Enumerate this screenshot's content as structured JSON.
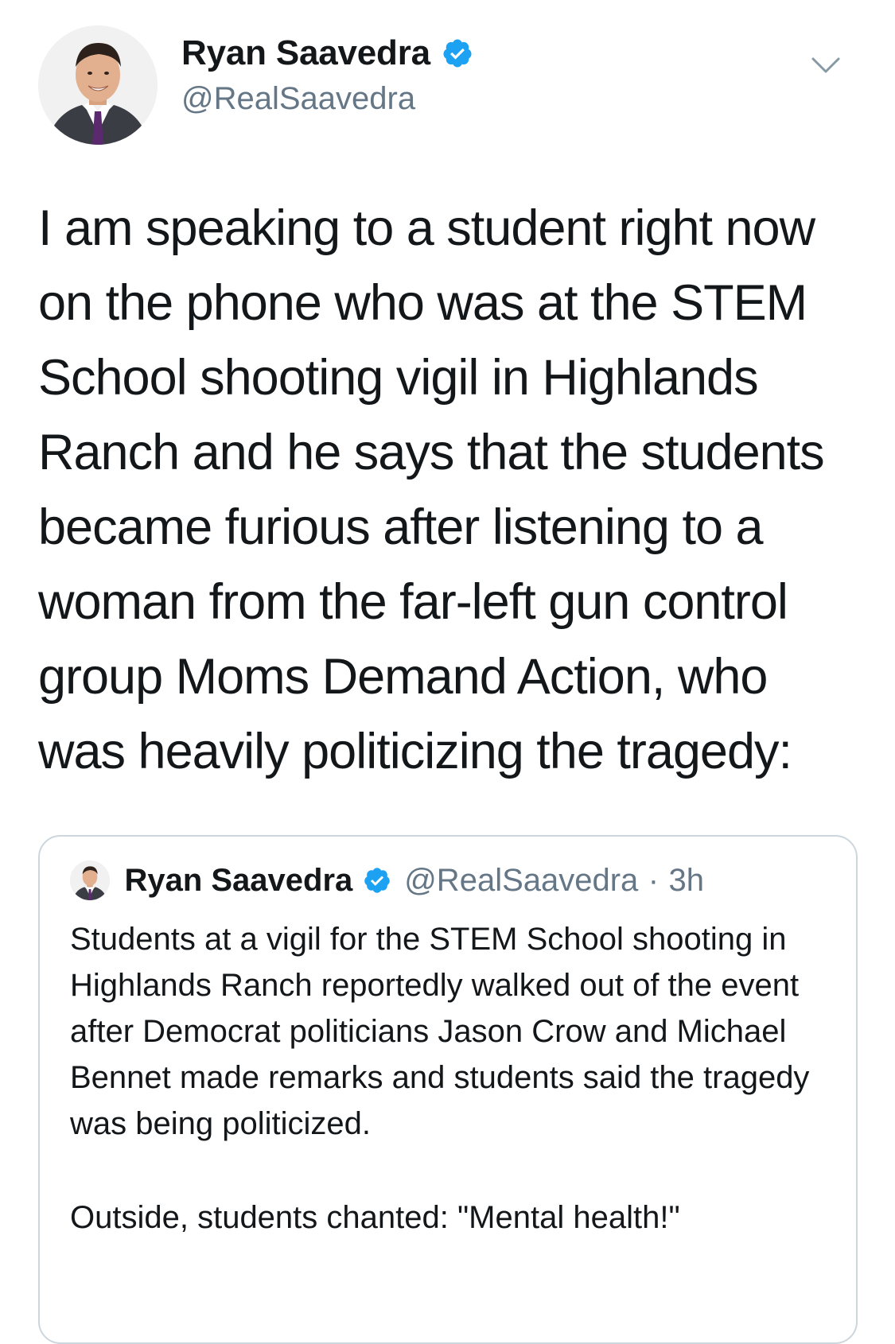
{
  "author": {
    "display_name": "Ryan Saavedra",
    "handle": "@RealSaavedra",
    "verified_icon": "verified-badge-icon"
  },
  "tweet": {
    "text": "I am speaking to a student right now on the phone who was at the STEM School shooting vigil in Highlands Ranch and he says that the students became furious after listening to a woman from the far-left gun control group Moms Demand Action, who was heavily politicizing the tragedy:"
  },
  "quoted_tweet": {
    "display_name": "Ryan Saavedra",
    "handle": "@RealSaavedra",
    "separator": "·",
    "time": "3h",
    "text": "Students at a vigil for the STEM School shooting in Highlands Ranch reportedly walked out of the event after Democrat politicians Jason Crow and Michael Bennet made remarks and students said the tragedy was being politicized.",
    "text_continued": "Outside, students chanted: \"Mental health!\""
  },
  "colors": {
    "text_primary": "#14171a",
    "text_secondary": "#657786",
    "verified_blue": "#1da1f2",
    "border": "#ccd6dd"
  }
}
